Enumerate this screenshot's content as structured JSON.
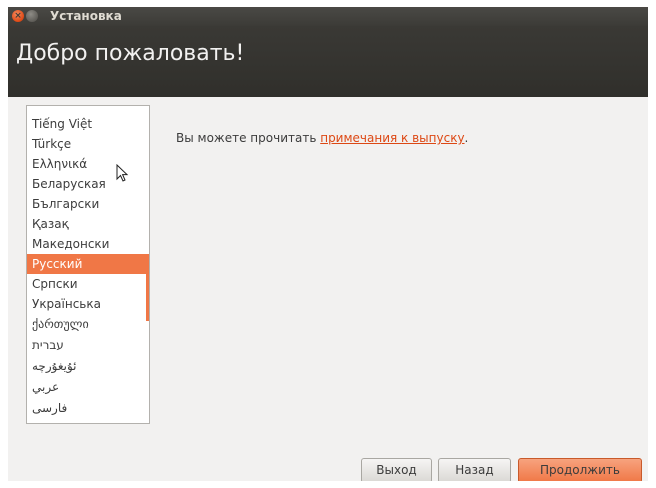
{
  "window": {
    "title": "Установка",
    "colors": {
      "accent": "#f07746",
      "header_bg": "#3c3b37",
      "link": "#dd4814",
      "close_button": "#dd4814"
    }
  },
  "header": {
    "title": "Добро пожаловать!"
  },
  "language_list": {
    "items": [
      "Tiếng Việt",
      "Türkçe",
      "Ελληνικά",
      "Беларуская",
      "Български",
      "Қазақ",
      "Македонски",
      "Русский",
      "Српски",
      "Українська",
      "ქართული",
      "עברית",
      "ئۇيغۇرچە",
      "عربي",
      "فارسی"
    ],
    "selected": "Русский"
  },
  "main": {
    "text_before_link": "Вы можете прочитать ",
    "link_text": "примечания к выпуску",
    "text_after_link": "."
  },
  "buttons": {
    "quit": "Выход",
    "back": "Назад",
    "continue": "Продолжить"
  }
}
